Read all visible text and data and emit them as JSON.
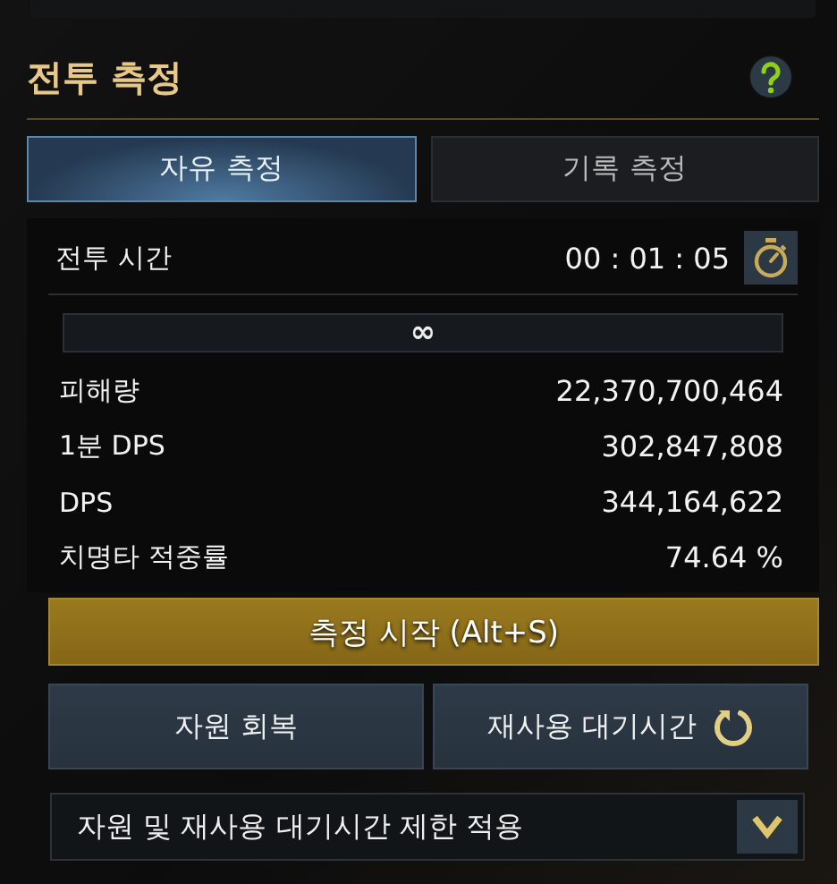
{
  "title": "전투 측정",
  "tabs": [
    {
      "label": "자유 측정",
      "selected": true
    },
    {
      "label": "기록 측정",
      "selected": false
    }
  ],
  "timer": {
    "label": "전투 시간",
    "value": "00 : 01 : 05"
  },
  "limit_bar": {
    "text": "∞"
  },
  "stats": [
    {
      "label": "피해량",
      "value": "22,370,700,464"
    },
    {
      "label": "1분 DPS",
      "value": "302,847,808"
    },
    {
      "label": "DPS",
      "value": "344,164,622"
    },
    {
      "label": "치명타 적중률",
      "value": "74.64 %"
    }
  ],
  "start_button": "측정 시작 (Alt+S)",
  "buttons": [
    {
      "label": "자원 회복",
      "kind": "plain"
    },
    {
      "label": "재사용 대기시간",
      "kind": "refresh"
    }
  ],
  "dropdown": {
    "value": "자원 및 재사용 대기시간 제한 적용"
  }
}
